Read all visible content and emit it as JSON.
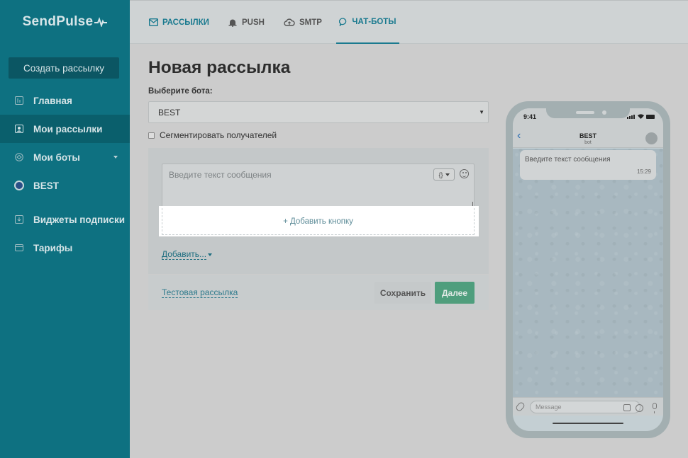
{
  "brand": {
    "name": "SendPulse"
  },
  "sidebar": {
    "create_button": "Создать рассылку",
    "items": [
      {
        "label": "Главная",
        "icon": "dashboard-icon"
      },
      {
        "label": "Мои рассылки",
        "icon": "mailings-icon",
        "active": true
      },
      {
        "label": "Мои боты",
        "icon": "bots-icon"
      },
      {
        "label": "BEST",
        "icon": "telegram-bot-icon"
      },
      {
        "label": "Виджеты подписки",
        "icon": "widget-icon"
      },
      {
        "label": "Тарифы",
        "icon": "tariff-icon"
      }
    ]
  },
  "topnav": {
    "tabs": [
      {
        "label": "РАССЫЛКИ",
        "icon": "mail-icon"
      },
      {
        "label": "PUSH",
        "icon": "bell-icon"
      },
      {
        "label": "SMTP",
        "icon": "cloud-icon"
      },
      {
        "label": "ЧАТ-БОТЫ",
        "icon": "chat-icon",
        "active": true
      }
    ]
  },
  "main": {
    "title": "Новая рассылка",
    "bot_label": "Выберите бота:",
    "bot_select_value": "BEST",
    "segment_label": "Сегментировать получателей",
    "message_placeholder": "Введите текст сообщения",
    "var_button": "{}",
    "add_button": "+ Добавить кнопку",
    "add_more": "Добавить...",
    "test_link": "Тестовая рассылка",
    "save": "Сохранить",
    "next": "Далее"
  },
  "phone": {
    "time": "9:41",
    "bot_name": "BEST",
    "bot_subtitle": "bot",
    "bubble_text": "Введите текст сообщения",
    "bubble_time": "15:29",
    "input_placeholder": "Message"
  },
  "colors": {
    "sidebar": "#0e7181",
    "accent": "#1a7a8f",
    "next_button": "#4e9e7d"
  }
}
